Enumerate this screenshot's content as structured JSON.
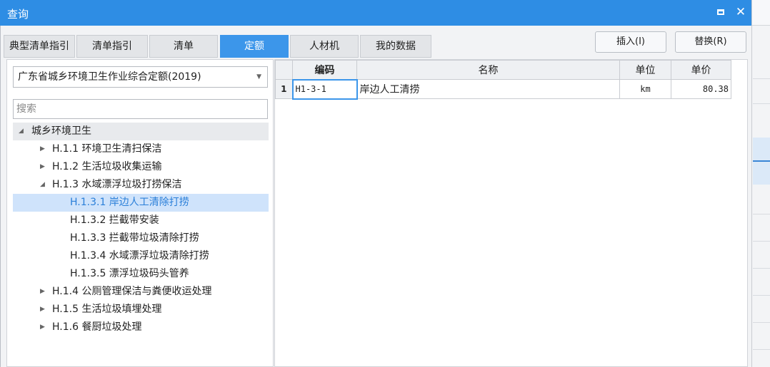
{
  "window": {
    "title": "查询"
  },
  "tabs": [
    {
      "label": "典型清单指引"
    },
    {
      "label": "清单指引"
    },
    {
      "label": "清单"
    },
    {
      "label": "定额"
    },
    {
      "label": "人材机"
    },
    {
      "label": "我的数据"
    }
  ],
  "active_tab": "定额",
  "actions": {
    "insert_label": "插入(I)",
    "replace_label": "替换(R)"
  },
  "library": {
    "selected": "广东省城乡环境卫生作业综合定额(2019)"
  },
  "search": {
    "placeholder": "搜索"
  },
  "tree": [
    {
      "label": "城乡环境卫生",
      "state": "expanded",
      "level": 0
    },
    {
      "label": "H.1.1 环境卫生清扫保洁",
      "state": "collapsed",
      "level": 1
    },
    {
      "label": "H.1.2 生活垃圾收集运输",
      "state": "collapsed",
      "level": 1
    },
    {
      "label": "H.1.3 水域漂浮垃圾打捞保洁",
      "state": "expanded",
      "level": 1
    },
    {
      "label": "H.1.3.1 岸边人工清除打捞",
      "state": "leaf",
      "level": 2,
      "selected": true
    },
    {
      "label": "H.1.3.2 拦截带安装",
      "state": "leaf",
      "level": 2
    },
    {
      "label": "H.1.3.3 拦截带垃圾清除打捞",
      "state": "leaf",
      "level": 2
    },
    {
      "label": "H.1.3.4 水域漂浮垃圾清除打捞",
      "state": "leaf",
      "level": 2
    },
    {
      "label": "H.1.3.5 漂浮垃圾码头管养",
      "state": "leaf",
      "level": 2
    },
    {
      "label": "H.1.4 公厕管理保洁与粪便收运处理",
      "state": "collapsed",
      "level": 1
    },
    {
      "label": "H.1.5 生活垃圾填埋处理",
      "state": "collapsed",
      "level": 1
    },
    {
      "label": "H.1.6 餐厨垃圾处理",
      "state": "collapsed",
      "level": 1
    }
  ],
  "table": {
    "headers": {
      "code": "编码",
      "name": "名称",
      "unit": "单位",
      "price": "单价"
    },
    "rows": [
      {
        "index": "1",
        "code": "H1-3-1",
        "name": "岸边人工清捞",
        "unit": "km",
        "price": "80.38"
      }
    ]
  },
  "colors": {
    "titlebar": "#2e8de4",
    "active_tab": "#3c96ea",
    "selected_row": "#cfe3fb"
  }
}
